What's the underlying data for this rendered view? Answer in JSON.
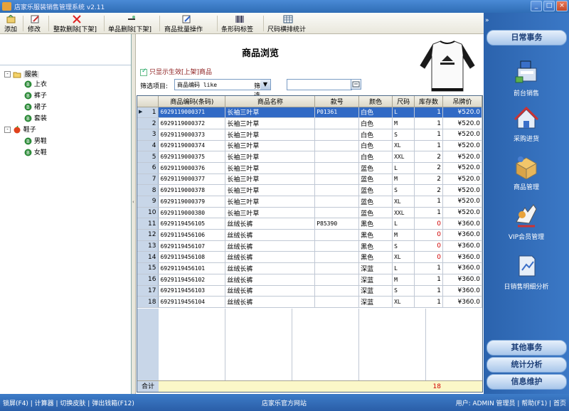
{
  "window": {
    "title": "店家乐服装销售管理系统 v2.11"
  },
  "toolbar": {
    "add": "添加",
    "edit": "修改",
    "delete_all": "整款删除[下架]",
    "delete_one": "单品删除[下架]",
    "batch": "商品批量操作",
    "barcode": "条形码标签",
    "size_stats": "尺码横排统计"
  },
  "tree": {
    "root1": "服装",
    "c1": "上衣",
    "c2": "裤子",
    "c3": "裙子",
    "c4": "套装",
    "root2": "鞋子",
    "c5": "男鞋",
    "c6": "女鞋"
  },
  "main": {
    "title": "商品浏览",
    "checkbox_label": "只显示生效[上架]商品",
    "filter_label": "筛选项目:",
    "filter_value": "商品编码 like",
    "content_label": "筛选内容:",
    "content_value": ""
  },
  "table": {
    "headers": [
      "商品编码(条码)",
      "商品名称",
      "款号",
      "颜色",
      "尺码",
      "库存数",
      "吊牌价"
    ],
    "rows": [
      [
        "1",
        "6929119000371",
        "长袖三叶草",
        "P01361",
        "白色",
        "L",
        "1",
        "¥520.0"
      ],
      [
        "2",
        "6929119000372",
        "长袖三叶草",
        "",
        "白色",
        "M",
        "1",
        "¥520.0"
      ],
      [
        "3",
        "6929119000373",
        "长袖三叶草",
        "",
        "白色",
        "S",
        "1",
        "¥520.0"
      ],
      [
        "4",
        "6929119000374",
        "长袖三叶草",
        "",
        "白色",
        "XL",
        "1",
        "¥520.0"
      ],
      [
        "5",
        "6929119000375",
        "长袖三叶草",
        "",
        "白色",
        "XXL",
        "2",
        "¥520.0"
      ],
      [
        "6",
        "6929119000376",
        "长袖三叶草",
        "",
        "蓝色",
        "L",
        "2",
        "¥520.0"
      ],
      [
        "7",
        "6929119000377",
        "长袖三叶草",
        "",
        "蓝色",
        "M",
        "2",
        "¥520.0"
      ],
      [
        "8",
        "6929119000378",
        "长袖三叶草",
        "",
        "蓝色",
        "S",
        "2",
        "¥520.0"
      ],
      [
        "9",
        "6929119000379",
        "长袖三叶草",
        "",
        "蓝色",
        "XL",
        "1",
        "¥520.0"
      ],
      [
        "10",
        "6929119000380",
        "长袖三叶草",
        "",
        "蓝色",
        "XXL",
        "1",
        "¥520.0"
      ],
      [
        "11",
        "6929119456105",
        "丝绒长裤",
        "P85390",
        "黑色",
        "L",
        "0",
        "¥360.0"
      ],
      [
        "12",
        "6929119456106",
        "丝绒长裤",
        "",
        "黑色",
        "M",
        "0",
        "¥360.0"
      ],
      [
        "13",
        "6929119456107",
        "丝绒长裤",
        "",
        "黑色",
        "S",
        "0",
        "¥360.0"
      ],
      [
        "14",
        "6929119456108",
        "丝绒长裤",
        "",
        "黑色",
        "XL",
        "0",
        "¥360.0"
      ],
      [
        "15",
        "6929119456101",
        "丝绒长裤",
        "",
        "深蓝",
        "L",
        "1",
        "¥360.0"
      ],
      [
        "16",
        "6929119456102",
        "丝绒长裤",
        "",
        "深蓝",
        "M",
        "1",
        "¥360.0"
      ],
      [
        "17",
        "6929119456103",
        "丝绒长裤",
        "",
        "深蓝",
        "S",
        "1",
        "¥360.0"
      ],
      [
        "18",
        "6929119456104",
        "丝绒长裤",
        "",
        "深蓝",
        "XL",
        "1",
        "¥360.0"
      ]
    ],
    "total_label": "合计",
    "total_stock": "18"
  },
  "status": {
    "left": "锁屏(F4) | 计算器 | 切换皮肤 | 弹出钱箱(F12)",
    "middle": "店家乐官方网站",
    "right": "用户: ADMIN 管理员 | 帮助(F1) | 首页"
  },
  "sidebar": {
    "collapse": "»",
    "daily": "日常事务",
    "items": [
      "前台销售",
      "采购进货",
      "商品管理",
      "VIP会员管理",
      "日销售明细分析"
    ],
    "other": "其他事务",
    "stats": "统计分析",
    "info": "信息维护"
  },
  "colors": {
    "selection": "#316ac5",
    "zero_stock": "#d00000",
    "panel_blue": "#2f6db5"
  }
}
